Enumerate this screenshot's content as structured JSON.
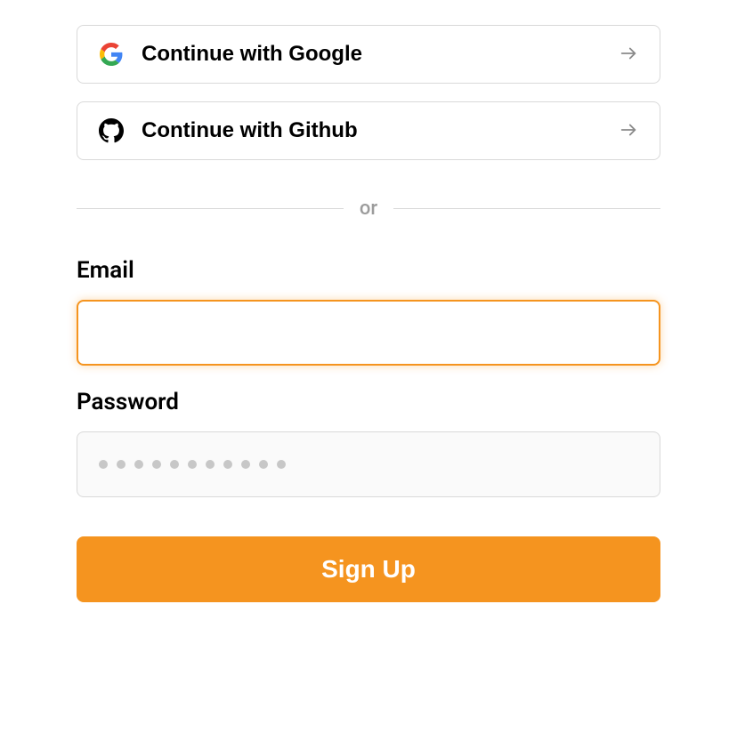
{
  "social": {
    "google_label": "Continue with Google",
    "github_label": "Continue with Github"
  },
  "divider": {
    "text": "or"
  },
  "form": {
    "email": {
      "label": "Email",
      "value": "",
      "focused": true
    },
    "password": {
      "label": "Password",
      "placeholder_dots": 11
    },
    "submit_label": "Sign Up"
  },
  "colors": {
    "accent": "#f5941f",
    "border": "#d9d9d9",
    "muted_text": "#9c9c9c"
  },
  "icons": {
    "google": "google-logo",
    "github": "github-logo",
    "arrow": "arrow-right"
  }
}
